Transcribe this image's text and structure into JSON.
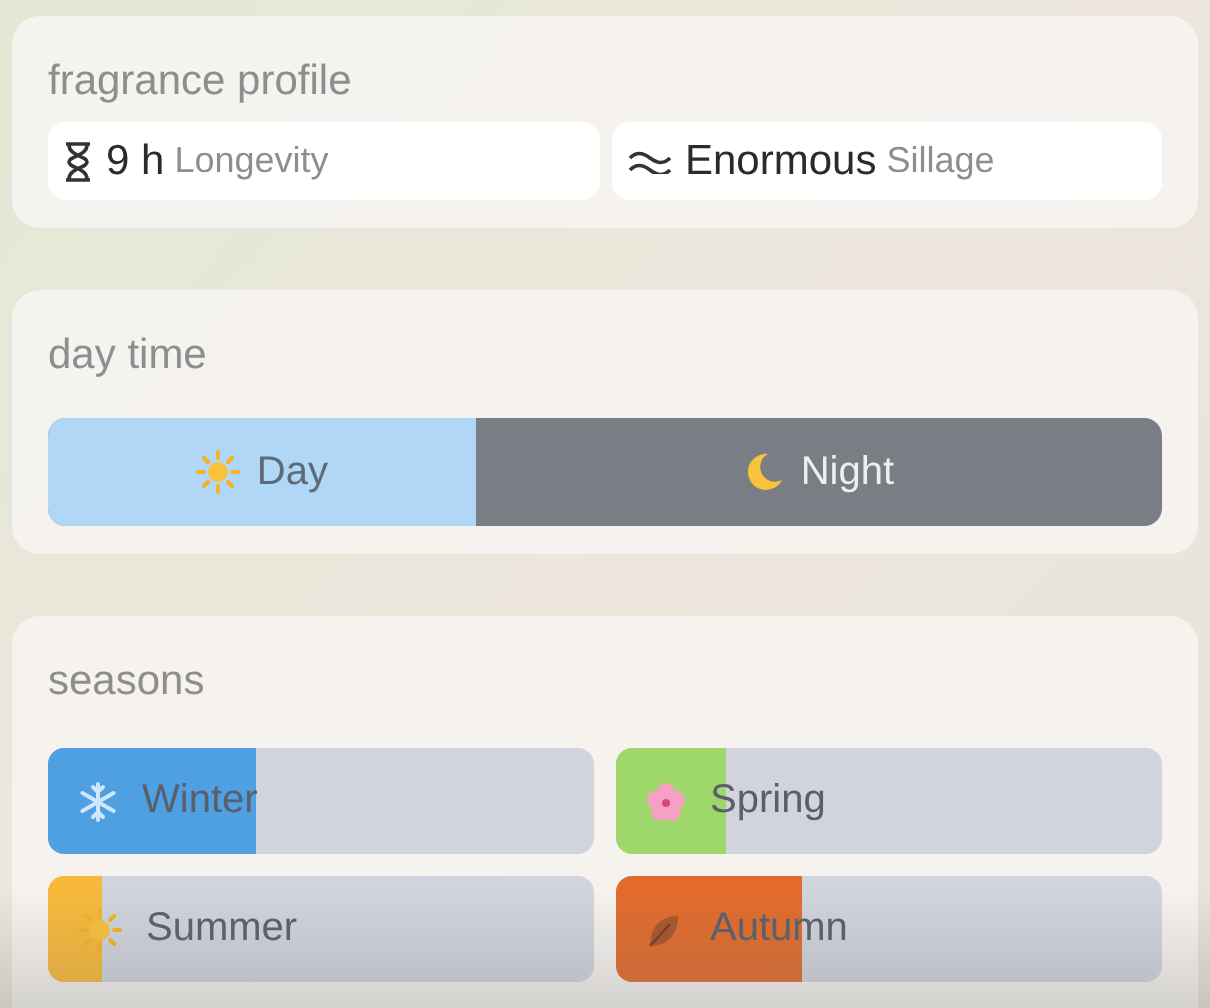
{
  "fragrance_profile": {
    "title": "fragrance profile",
    "stats": [
      {
        "kind": "longevity",
        "value": "9 h",
        "label": "Longevity"
      },
      {
        "kind": "sillage",
        "value": "Enormous",
        "label": "Sillage"
      }
    ]
  },
  "day_time": {
    "title": "day time",
    "level": 0.385,
    "segments": [
      {
        "kind": "day",
        "label": "Day"
      },
      {
        "kind": "night",
        "label": "Night"
      }
    ]
  },
  "seasons": {
    "title": "seasons",
    "items": [
      {
        "kind": "winter",
        "label": "Winter",
        "level": 0.38,
        "color": "#4f9fe3"
      },
      {
        "kind": "spring",
        "label": "Spring",
        "level": 0.2,
        "color": "#9fd86a"
      },
      {
        "kind": "summer",
        "label": "Summer",
        "level": 0.1,
        "color": "#f8b93a"
      },
      {
        "kind": "autumn",
        "label": "Autumn",
        "level": 0.34,
        "color": "#e26b2c"
      }
    ]
  }
}
